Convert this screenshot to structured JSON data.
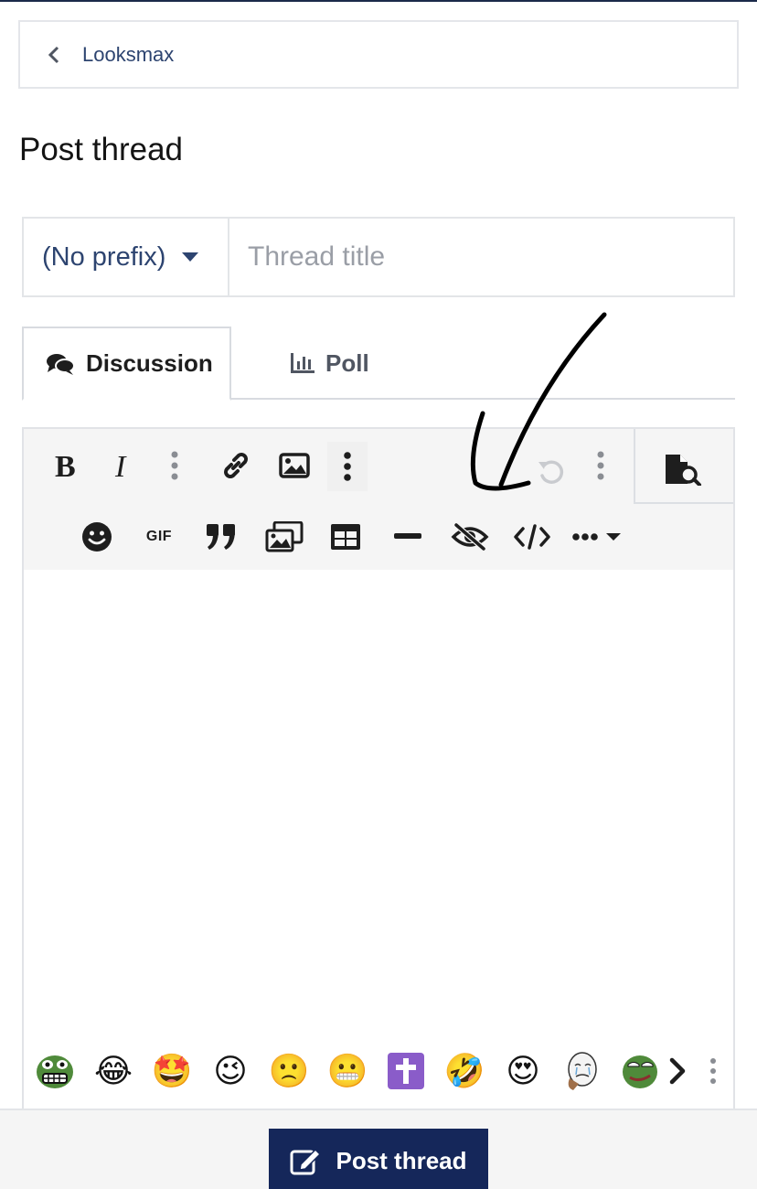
{
  "breadcrumb": {
    "label": "Looksmax"
  },
  "page": {
    "title": "Post thread"
  },
  "form": {
    "prefix_label": "(No prefix)",
    "title_placeholder": "Thread title"
  },
  "tabs": [
    {
      "label": "Discussion",
      "icon": "comments-icon",
      "active": true
    },
    {
      "label": "Poll",
      "icon": "bar-chart-icon",
      "active": false
    }
  ],
  "toolbar": {
    "gif_label": "GIF",
    "row1": [
      "bold-icon",
      "italic-icon",
      "more-vertical-icon",
      "link-icon",
      "image-icon",
      "more-vertical-icon",
      "undo-icon",
      "more-vertical-icon",
      "preview-icon"
    ],
    "row2": [
      "smilie-icon",
      "gif-icon",
      "quote-icon",
      "media-icon",
      "table-icon",
      "horizontal-rule-icon",
      "spoiler-eye-slash-icon",
      "code-icon",
      "more-options-icon"
    ]
  },
  "smilies": [
    "pepe-grimace",
    "😂",
    "🤩",
    "😉",
    "🙁",
    "😬",
    "✝️",
    "🤣",
    "😍",
    "crying-wojak",
    "pepe-smug"
  ],
  "footer": {
    "submit_label": "Post thread"
  },
  "colors": {
    "accent": "#15275a",
    "link": "#2d4470",
    "toolbar_bg": "#f5f5f5",
    "border": "#e3e5e8"
  }
}
